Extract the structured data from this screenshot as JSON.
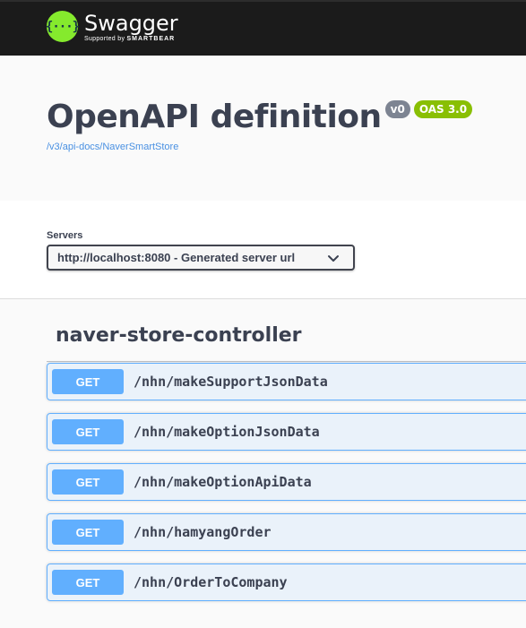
{
  "brand": {
    "logo_glyph": "{···}",
    "name": "Swagger",
    "supported_by": "Supported by",
    "company": "SMARTBEAR",
    "accent_color": "#85ea2d"
  },
  "info": {
    "title": "OpenAPI definition",
    "version_badge": "v0",
    "oas_badge": "OAS 3.0",
    "spec_link": "/v3/api-docs/NaverSmartStore"
  },
  "servers": {
    "label": "Servers",
    "selected": "http://localhost:8080 - Generated server url",
    "icon": "chevron-down-icon"
  },
  "tag": {
    "name": "naver-store-controller"
  },
  "operations": [
    {
      "method": "GET",
      "path": "/nhn/makeSupportJsonData"
    },
    {
      "method": "GET",
      "path": "/nhn/makeOptionJsonData"
    },
    {
      "method": "GET",
      "path": "/nhn/makeOptionApiData"
    },
    {
      "method": "GET",
      "path": "/nhn/hamyangOrder"
    },
    {
      "method": "GET",
      "path": "/nhn/OrderToCompany"
    }
  ],
  "colors": {
    "get_method": "#61affe",
    "oas_badge": "#89bf04",
    "version_badge": "#7d8492",
    "topbar": "#1b1b1b"
  }
}
